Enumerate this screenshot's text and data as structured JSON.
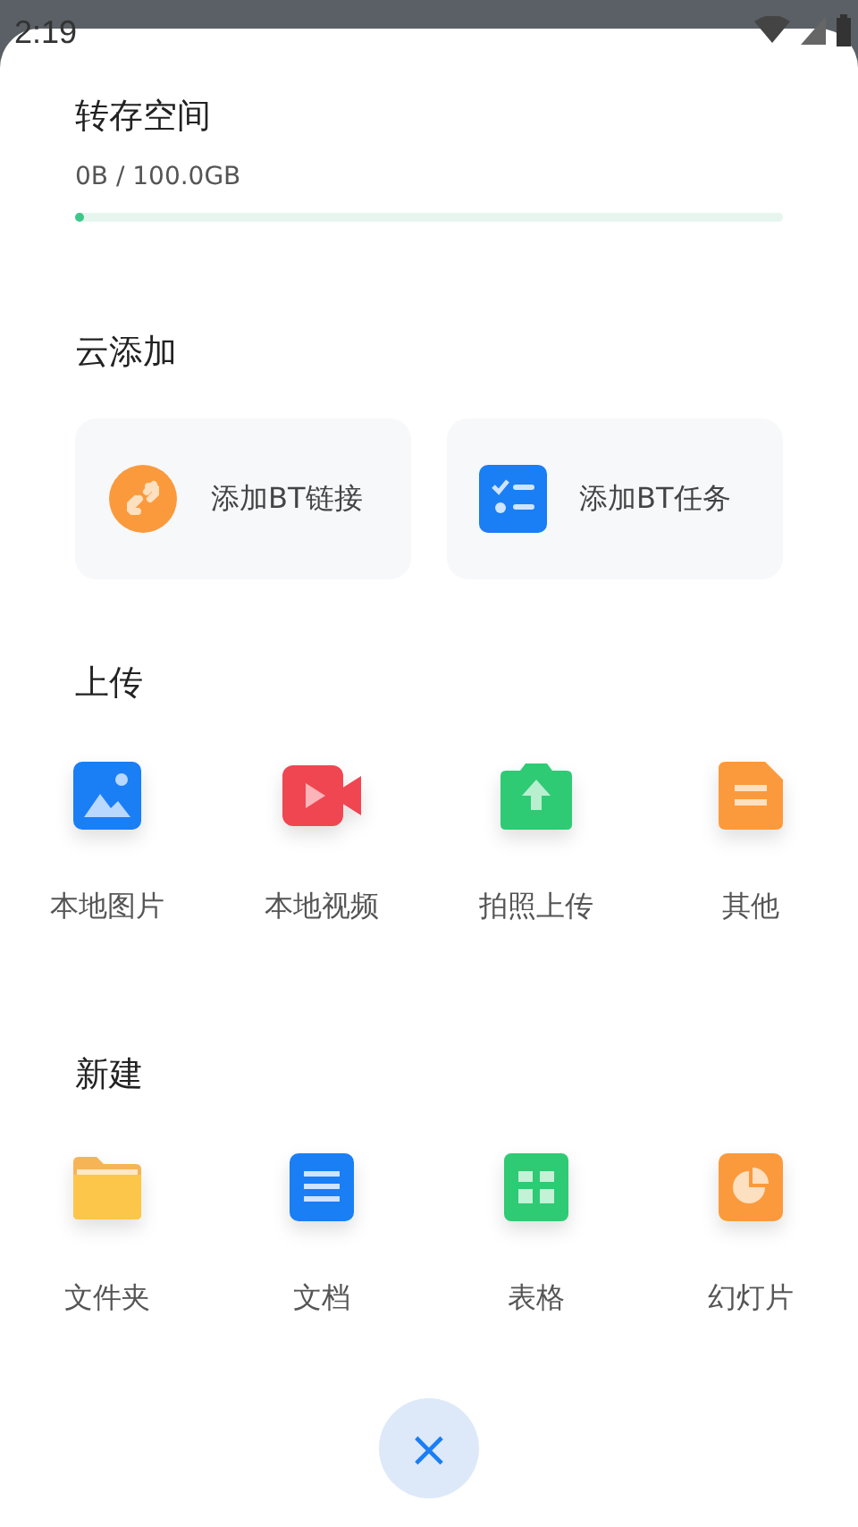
{
  "status_bar": {
    "time": "2:19"
  },
  "storage": {
    "title": "转存空间",
    "usage": "0B / 100.0GB",
    "level": 0.01
  },
  "cloud_add": {
    "title": "云添加",
    "items": [
      {
        "kind": "link",
        "label": "添加BT链接"
      },
      {
        "kind": "tasklist",
        "label": "添加BT任务"
      }
    ]
  },
  "upload": {
    "title": "上传",
    "items": [
      {
        "kind": "image",
        "label": "本地图片"
      },
      {
        "kind": "video",
        "label": "本地视频"
      },
      {
        "kind": "camera",
        "label": "拍照上传"
      },
      {
        "kind": "file",
        "label": "其他"
      }
    ]
  },
  "create": {
    "title": "新建",
    "items": [
      {
        "kind": "folder",
        "label": "文件夹"
      },
      {
        "kind": "doc",
        "label": "文档"
      },
      {
        "kind": "sheet",
        "label": "表格"
      },
      {
        "kind": "slides",
        "label": "幻灯片"
      }
    ]
  },
  "close_button": {
    "symbol": "×"
  }
}
